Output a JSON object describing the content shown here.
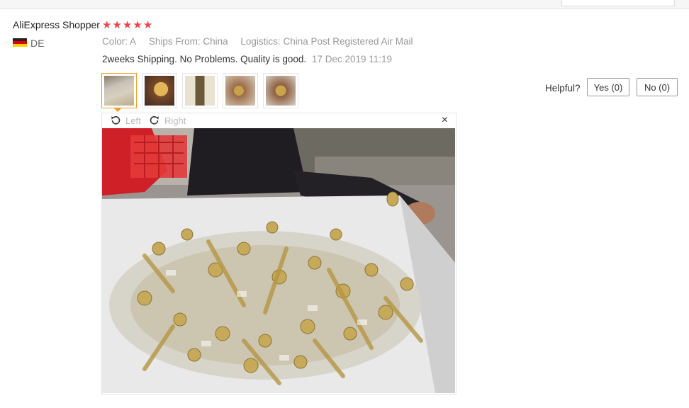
{
  "review": {
    "buyer_name": "AliExpress Shopper",
    "rating": 5,
    "country_code": "DE",
    "color_label": "Color:",
    "color_value": "A",
    "ships_label": "Ships From:",
    "ships_value": "China",
    "logistics_label": "Logistics:",
    "logistics_value": "China Post Registered Air Mail",
    "text": "2weeks Shipping. No Problems. Quality is good.",
    "date": "17 Dec 2019 11:19"
  },
  "helpful": {
    "label": "Helpful?",
    "yes_label": "Yes (0)",
    "no_label": "No (0)"
  },
  "viewer": {
    "rotate_left_label": "Left",
    "rotate_right_label": "Right",
    "close_glyph": "×"
  },
  "icons": {
    "star": "star-icon",
    "flag": "germany-flag-icon",
    "rotate_left": "rotate-left-icon",
    "rotate_right": "rotate-right-icon",
    "close": "close-icon"
  },
  "colors": {
    "star": "#f0464a",
    "thumb_active_border": "#f59a23",
    "muted_text": "#999999"
  }
}
